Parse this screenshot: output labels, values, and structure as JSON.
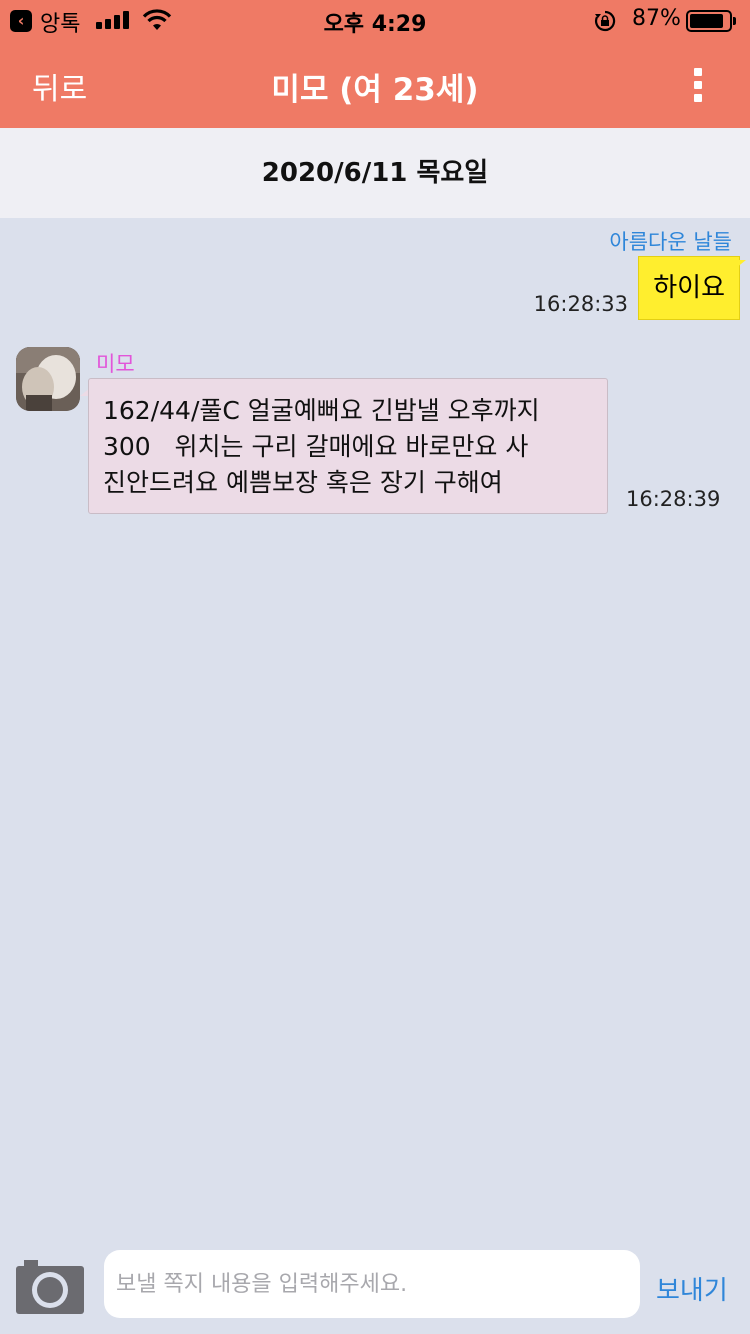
{
  "status_bar": {
    "back_app": "앙톡",
    "time": "오후 4:29",
    "battery": "87%",
    "battery_level": 0.87
  },
  "nav": {
    "back_label": "뒤로",
    "title": "미모 (여 23세)",
    "more_icon": "vertical-dots-icon"
  },
  "date_header": "2020/6/11 목요일",
  "messages": [
    {
      "direction": "outgoing",
      "sender": "아름다운 날들",
      "text": "하이요",
      "time": "16:28:33"
    },
    {
      "direction": "incoming",
      "sender": "미모",
      "lines": [
        "162/44/풀C 얼굴예뻐요 긴밤낼 오후까지",
        "300   위치는 구리 갈매에요 바로만요 사",
        "진안드려요 예쁨보장 혹은 장기 구해여"
      ],
      "time": "16:28:39"
    }
  ],
  "composer": {
    "camera_icon": "camera-icon",
    "placeholder": "보낼 쪽지 내용을 입력해주세요.",
    "value": "",
    "send_label": "보내기"
  },
  "colors": {
    "header": "#ef7a65",
    "chat_background": "#dbe0ec",
    "outgoing_bubble": "#ffee2e",
    "incoming_bubble": "#ecdbe6",
    "outgoing_name": "#2f86d9",
    "incoming_name": "#e255d9",
    "send_button": "#2f86d9"
  }
}
